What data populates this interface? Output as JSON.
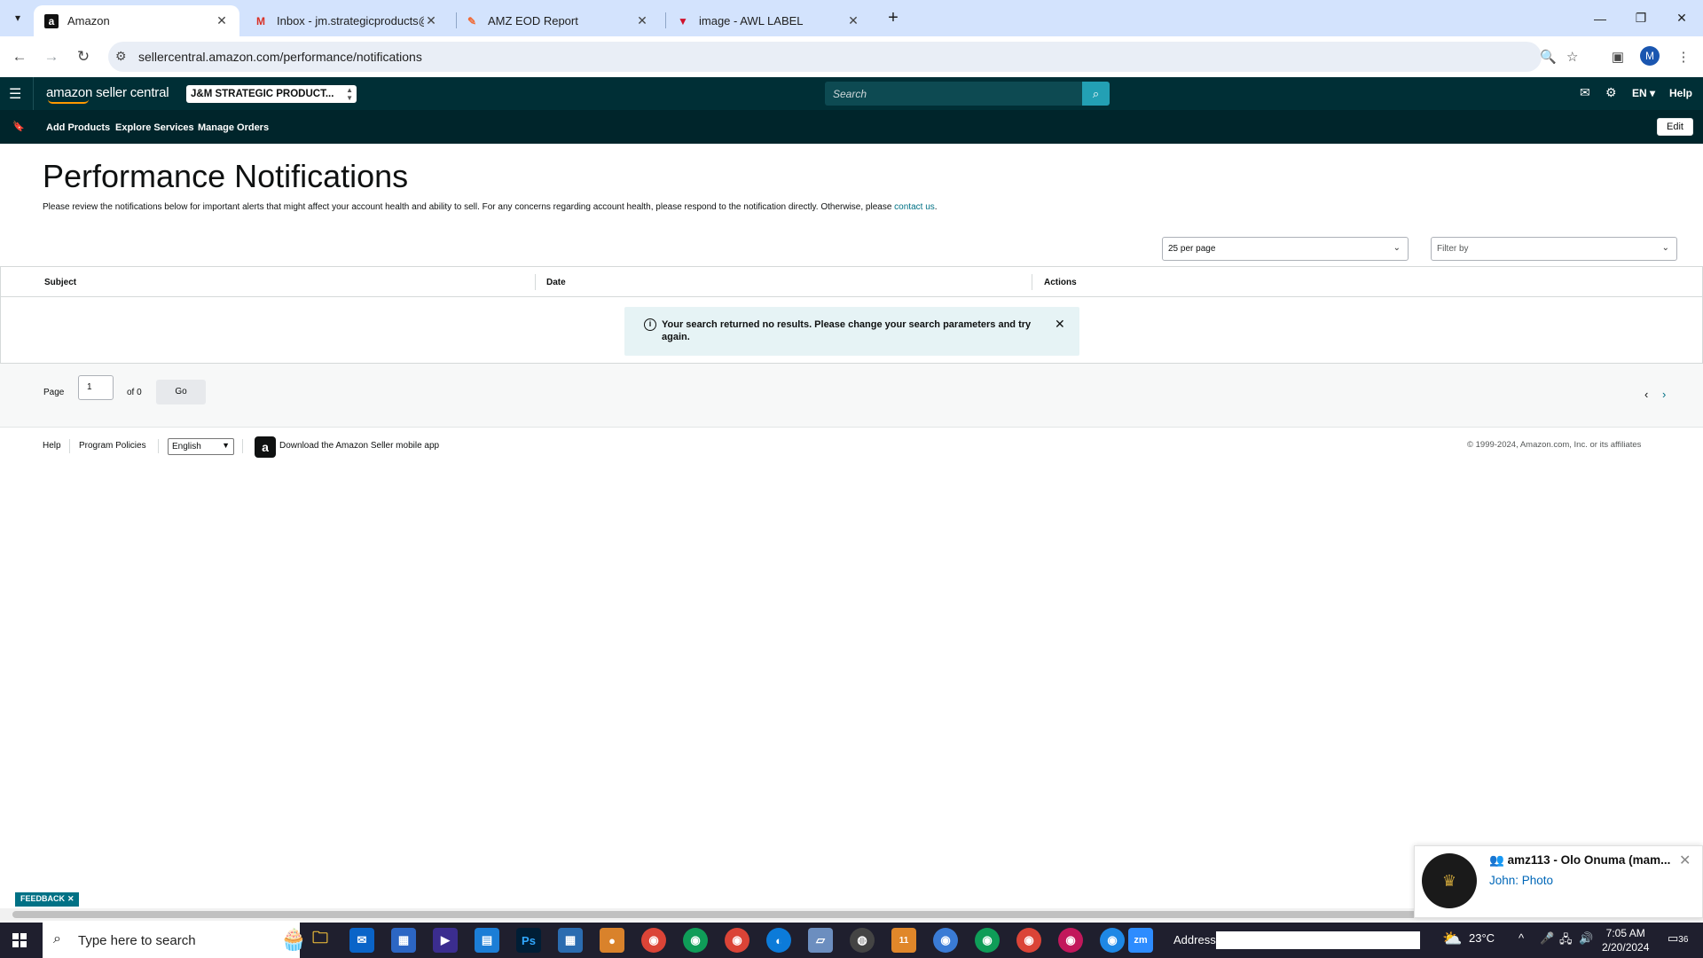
{
  "browser": {
    "tabs": [
      {
        "title": "Amazon",
        "icon": "amazon-icon",
        "active": true
      },
      {
        "title": "Inbox - jm.strategicproducts@g",
        "icon": "gmail-icon",
        "active": false
      },
      {
        "title": "AMZ EOD Report",
        "icon": "sheets-icon",
        "active": false
      },
      {
        "title": "image - AWL LABEL",
        "icon": "image-icon",
        "active": false
      }
    ],
    "url": "sellercentral.amazon.com/performance/notifications",
    "profile_initial": "M"
  },
  "header": {
    "logo_text": "amazon seller central",
    "account": "J&M STRATEGIC PRODUCT...",
    "search_placeholder": "Search",
    "lang": "EN",
    "help": "Help"
  },
  "nav": {
    "links": [
      "Add Products",
      "Explore Services",
      "Manage Orders"
    ],
    "edit": "Edit"
  },
  "page": {
    "title": "Performance Notifications",
    "description": "Please review the notifications below for important alerts that might affect your account health and ability to sell. For any concerns regarding account health, please respond to the notification directly. Otherwise, please",
    "contact_link": "contact us",
    "per_page": "25 per page",
    "filter_placeholder": "Filter by",
    "columns": [
      "Subject",
      "Date",
      "Actions"
    ],
    "alert": "Your search returned no results. Please change your search parameters and try again.",
    "pager": {
      "page_label": "Page",
      "page_value": "1",
      "of_label": "of 0",
      "go": "Go"
    }
  },
  "footer": {
    "links": [
      "Help",
      "Program Policies"
    ],
    "language": "English",
    "app_text": "Download the Amazon Seller mobile app",
    "copyright": "© 1999-2024, Amazon.com, Inc. or its affiliates"
  },
  "feedback": "FEEDBACK",
  "popup": {
    "title": "amz113 - Olo Onuma (mam...",
    "subtitle": "John: Photo"
  },
  "taskbar": {
    "search_placeholder": "Type here to search",
    "address_label": "Address",
    "temperature": "23°C",
    "time": "7:05 AM",
    "date": "2/20/2024",
    "notification_count": "36",
    "telegram_badge": "11"
  }
}
